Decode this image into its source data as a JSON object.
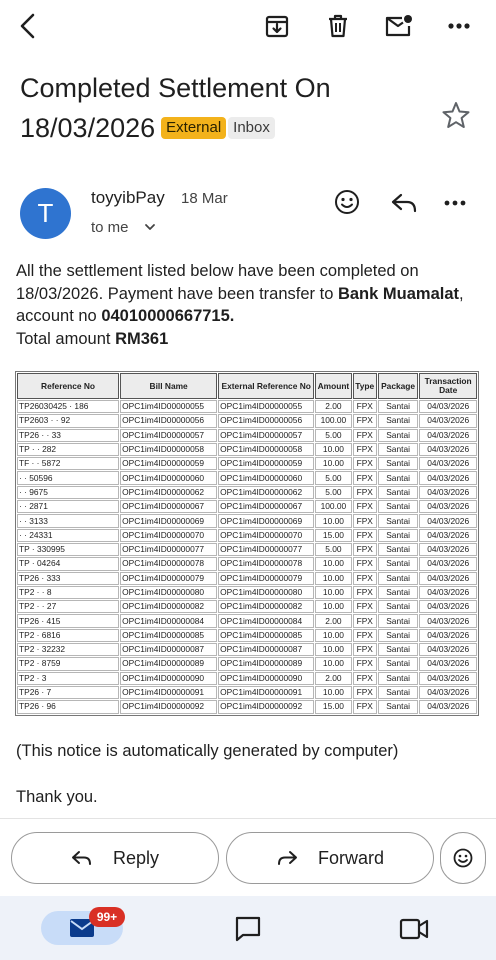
{
  "toolbar": {
    "back_icon": "arrow-left-icon",
    "archive_icon": "archive-icon",
    "delete_icon": "trash-icon",
    "mark_unread_icon": "mail-unread-icon",
    "more_icon": "more-vert-icon"
  },
  "email": {
    "subject_line1": "Completed Settlement On",
    "subject_line2": "18/03/2026",
    "label_external": "External",
    "label_inbox": "Inbox",
    "sender_initial": "T",
    "sender_name": "toyyibPay",
    "date": "18 Mar",
    "recipient": "to me",
    "body": {
      "p1_a": "All the settlement listed below have been completed on 18/03/2026. Payment have been transfer to ",
      "bank": "Bank Muamalat",
      "p1_b": ", account no ",
      "account": "04010000667715.",
      "total_label": "Total amount ",
      "total_value": "RM361"
    },
    "notice": "(This notice is automatically generated by computer)",
    "thanks": "Thank you."
  },
  "table": {
    "headers": [
      "Reference No",
      "Bill Name",
      "External Reference No",
      "Amount",
      "Type",
      "Package",
      "Transaction Date"
    ],
    "rows": [
      [
        "TP26030425 · 186",
        "OPC1im4ID00000055",
        "OPC1im4ID00000055",
        "2.00",
        "FPX",
        "Santai",
        "04/03/2026"
      ],
      [
        "TP2603 · · 92",
        "OPC1im4ID00000056",
        "OPC1im4ID00000056",
        "100.00",
        "FPX",
        "Santai",
        "04/03/2026"
      ],
      [
        "TP26 · · 33",
        "OPC1im4ID00000057",
        "OPC1im4ID00000057",
        "5.00",
        "FPX",
        "Santai",
        "04/03/2026"
      ],
      [
        "TP · · 282",
        "OPC1im4ID00000058",
        "OPC1im4ID00000058",
        "10.00",
        "FPX",
        "Santai",
        "04/03/2026"
      ],
      [
        "TF · · 5872",
        "OPC1im4ID00000059",
        "OPC1im4ID00000059",
        "10.00",
        "FPX",
        "Santai",
        "04/03/2026"
      ],
      [
        "· · 50596",
        "OPC1im4ID00000060",
        "OPC1im4ID00000060",
        "5.00",
        "FPX",
        "Santai",
        "04/03/2026"
      ],
      [
        "· · 9675",
        "OPC1im4ID00000062",
        "OPC1im4ID00000062",
        "5.00",
        "FPX",
        "Santai",
        "04/03/2026"
      ],
      [
        "· · 2871",
        "OPC1im4ID00000067",
        "OPC1im4ID00000067",
        "100.00",
        "FPX",
        "Santai",
        "04/03/2026"
      ],
      [
        "· · 3133",
        "OPC1im4ID00000069",
        "OPC1im4ID00000069",
        "10.00",
        "FPX",
        "Santai",
        "04/03/2026"
      ],
      [
        "· · 24331",
        "OPC1im4ID00000070",
        "OPC1im4ID00000070",
        "15.00",
        "FPX",
        "Santai",
        "04/03/2026"
      ],
      [
        "TP · 330995",
        "OPC1im4ID00000077",
        "OPC1im4ID00000077",
        "5.00",
        "FPX",
        "Santai",
        "04/03/2026"
      ],
      [
        "TP · 04264",
        "OPC1im4ID00000078",
        "OPC1im4ID00000078",
        "10.00",
        "FPX",
        "Santai",
        "04/03/2026"
      ],
      [
        "TP26 · 333",
        "OPC1im4ID00000079",
        "OPC1im4ID00000079",
        "10.00",
        "FPX",
        "Santai",
        "04/03/2026"
      ],
      [
        "TP2 · · 8",
        "OPC1im4ID00000080",
        "OPC1im4ID00000080",
        "10.00",
        "FPX",
        "Santai",
        "04/03/2026"
      ],
      [
        "TP2 · · 27",
        "OPC1im4ID00000082",
        "OPC1im4ID00000082",
        "10.00",
        "FPX",
        "Santai",
        "04/03/2026"
      ],
      [
        "TP26 · 415",
        "OPC1im4ID00000084",
        "OPC1im4ID00000084",
        "2.00",
        "FPX",
        "Santai",
        "04/03/2026"
      ],
      [
        "TP2 · 6816",
        "OPC1im4ID00000085",
        "OPC1im4ID00000085",
        "10.00",
        "FPX",
        "Santai",
        "04/03/2026"
      ],
      [
        "TP2 · 32232",
        "OPC1im4ID00000087",
        "OPC1im4ID00000087",
        "10.00",
        "FPX",
        "Santai",
        "04/03/2026"
      ],
      [
        "TP2 · 8759",
        "OPC1im4ID00000089",
        "OPC1im4ID00000089",
        "10.00",
        "FPX",
        "Santai",
        "04/03/2026"
      ],
      [
        "TP2 · 3",
        "OPC1im4ID00000090",
        "OPC1im4ID00000090",
        "2.00",
        "FPX",
        "Santai",
        "04/03/2026"
      ],
      [
        "TP26 · 7",
        "OPC1im4ID00000091",
        "OPC1im4ID00000091",
        "10.00",
        "FPX",
        "Santai",
        "04/03/2026"
      ],
      [
        "TP26 · 96",
        "OPC1im4ID00000092",
        "OPC1im4ID00000092",
        "15.00",
        "FPX",
        "Santai",
        "04/03/2026"
      ]
    ]
  },
  "actions": {
    "reply_label": "Reply",
    "forward_label": "Forward",
    "emoji_icon": "add-reaction-icon"
  },
  "bottom_nav": {
    "mail_badge": "99+",
    "mail_icon": "mail-icon",
    "chat_icon": "chat-icon",
    "meet_icon": "video-icon"
  },
  "colors": {
    "external_chip": "#f3b21b",
    "avatar": "#2f74d0",
    "badge": "#d93025",
    "nav_bg": "#eef2f9",
    "mail_pill": "#c8dcf8"
  }
}
